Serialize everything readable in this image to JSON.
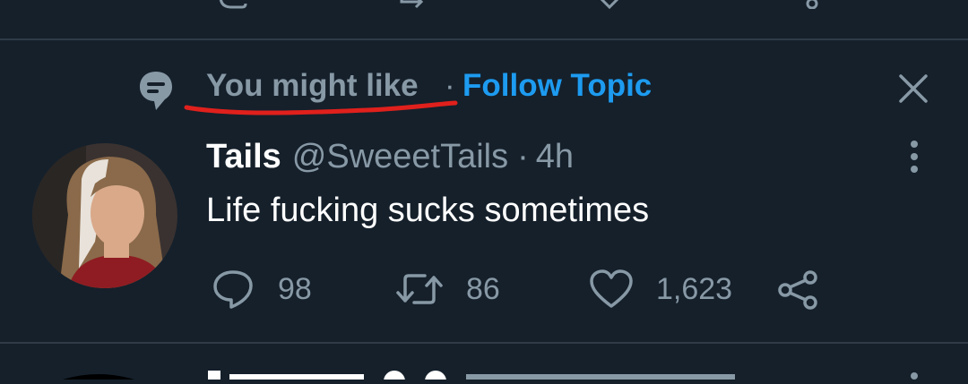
{
  "promo": {
    "label": "You might like",
    "separator": "·",
    "follow": "Follow Topic"
  },
  "tweet": {
    "name": "Tails",
    "handle": "@SweeetTails",
    "separator": "·",
    "time": "4h",
    "text": "Life fucking sucks sometimes",
    "replies": "98",
    "retweets": "86",
    "likes": "1,623"
  },
  "icons": {
    "topic": "topic-bubble-icon",
    "close": "close-icon",
    "more": "more-vertical-icon",
    "reply": "reply-icon",
    "retweet": "retweet-icon",
    "like": "heart-icon",
    "share": "share-icon"
  },
  "colors": {
    "background": "#15202b",
    "text_secondary": "#8899a6",
    "accent": "#1d9bf0",
    "annotation": "#e0201c",
    "divider": "#2f3b47"
  }
}
